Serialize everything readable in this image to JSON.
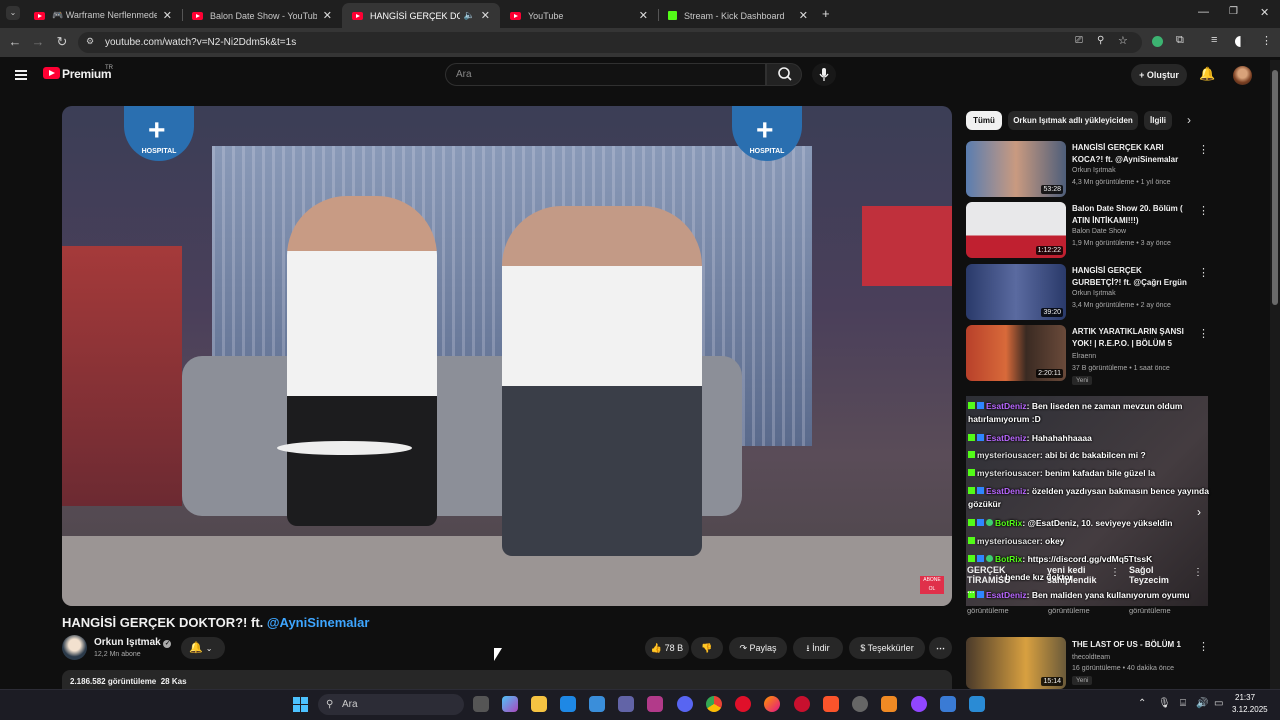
{
  "browser": {
    "tabs": [
      {
        "title": "🎮 Warframe Nerflenmeden Ö",
        "type": "youtube",
        "active": false
      },
      {
        "title": "Balon Date Show - YouTube",
        "type": "youtube",
        "active": false
      },
      {
        "title": "HANGİSİ GERÇEK DOKTOR",
        "type": "youtube",
        "active": true
      },
      {
        "title": "YouTube",
        "type": "youtube",
        "active": false
      },
      {
        "title": "Stream - Kick Dashboard",
        "type": "kick",
        "active": false
      }
    ],
    "url": "youtube.com/watch?v=N2-Ni2Ddm5k&t=1s"
  },
  "header": {
    "logo": "Premium",
    "logo_region": "TR",
    "search_placeholder": "Ara",
    "create_label": "Oluştur"
  },
  "video": {
    "title": "HANGİSİ GERÇEK DOKTOR?! ft. ",
    "title_link": "@AyniSinemalar",
    "sign_text": "HOSPITAL",
    "channel_name": "Orkun Işıtmak",
    "subscribers": "12,2 Mn abone",
    "likes": "78 B",
    "share_label": "Paylaş",
    "download_label": "İndir",
    "thanks_label": "Teşekkürler",
    "views": "2.186.582 görüntüleme",
    "date": "28 Kas"
  },
  "chips": [
    {
      "label": "Tümü",
      "active": true
    },
    {
      "label": "Orkun Işıtmak adlı yükleyiciden",
      "active": false
    },
    {
      "label": "İlgili",
      "active": false
    }
  ],
  "recommendations": [
    {
      "title": "HANGİSİ GERÇEK KARI KOCA?! ft. @AyniSinemalar",
      "channel": "Orkun Işıtmak",
      "meta": "4,3 Mn görüntüleme • 1 yıl önce",
      "duration": "53:28"
    },
    {
      "title": "Balon Date Show 20. Bölüm ( ATIN İNTİKAMI!!!)",
      "channel": "Balon Date Show",
      "meta": "1,9 Mn görüntüleme • 3 ay önce",
      "duration": "1:12:22"
    },
    {
      "title": "HANGİSİ GERÇEK GURBETÇİ?! ft. @Çağrı Ergün",
      "channel": "Orkun Işıtmak",
      "meta": "3,4 Mn görüntüleme • 2 ay önce",
      "duration": "39:20"
    },
    {
      "title": "ARTIK YARATIKLARIN ŞANSI YOK! | R.E.P.O. | BÖLÜM 5",
      "channel": "Elraenn",
      "meta": "37 B görüntüleme • 1 saat önce",
      "duration": "2:20:11",
      "badge": "Yeni"
    },
    {
      "title": "THE LAST OF US - BÖLÜM 1",
      "channel": "thecoldteam",
      "meta": "16 görüntüleme • 40 dakika önce",
      "duration": "15:14",
      "badge": "Yeni"
    }
  ],
  "chat": [
    {
      "user": "EsatDeniz",
      "msg": ": Ben liseden ne zaman mevzun oldum hatırlamıyorum :D",
      "style": "n1"
    },
    {
      "user": "EsatDeniz",
      "msg": ": Hahahahhaaaa",
      "style": "n1"
    },
    {
      "user": "mysteriousacer",
      "msg": ": abi bi dc bakabilcen mi ?",
      "style": "n2"
    },
    {
      "user": "mysteriousacer",
      "msg": ": benim kafadan bile güzel la",
      "style": "n2"
    },
    {
      "user": "EsatDeniz",
      "msg": ": özelden yazdıysan bakmasın bence yayında gözükür",
      "style": "n1"
    },
    {
      "user": "BotRix",
      "msg": ": @EsatDeniz, 10. seviyeye yükseldin",
      "style": "n3"
    },
    {
      "user": "mysteriousacer",
      "msg": ": okey",
      "style": "n2"
    },
    {
      "user": "BotRix",
      "msg": ": https://discord.gg/vdMq5TtssK",
      "style": "n3"
    },
    {
      "user": "",
      "msg": ": bende kız doktor",
      "style": "n2"
    },
    {
      "user": "EsatDeniz",
      "msg": ": Ben maliden yana kullanıyorum oyumu",
      "style": "n1"
    }
  ],
  "shorts": [
    {
      "label": "GERÇEK TİRAMİSU ...",
      "views": "görüntüleme"
    },
    {
      "label": "yeni kedi sahiplendik",
      "views": "görüntüleme"
    },
    {
      "label": "Sağol Teyzecim",
      "views": "görüntüleme"
    }
  ],
  "taskbar": {
    "search": "Ara",
    "time": "21:37",
    "date": "3.12.2025"
  },
  "colors": {
    "youtube_red": "#ff0033",
    "kick_green": "#53fc18",
    "link_blue": "#3ea6ff"
  }
}
